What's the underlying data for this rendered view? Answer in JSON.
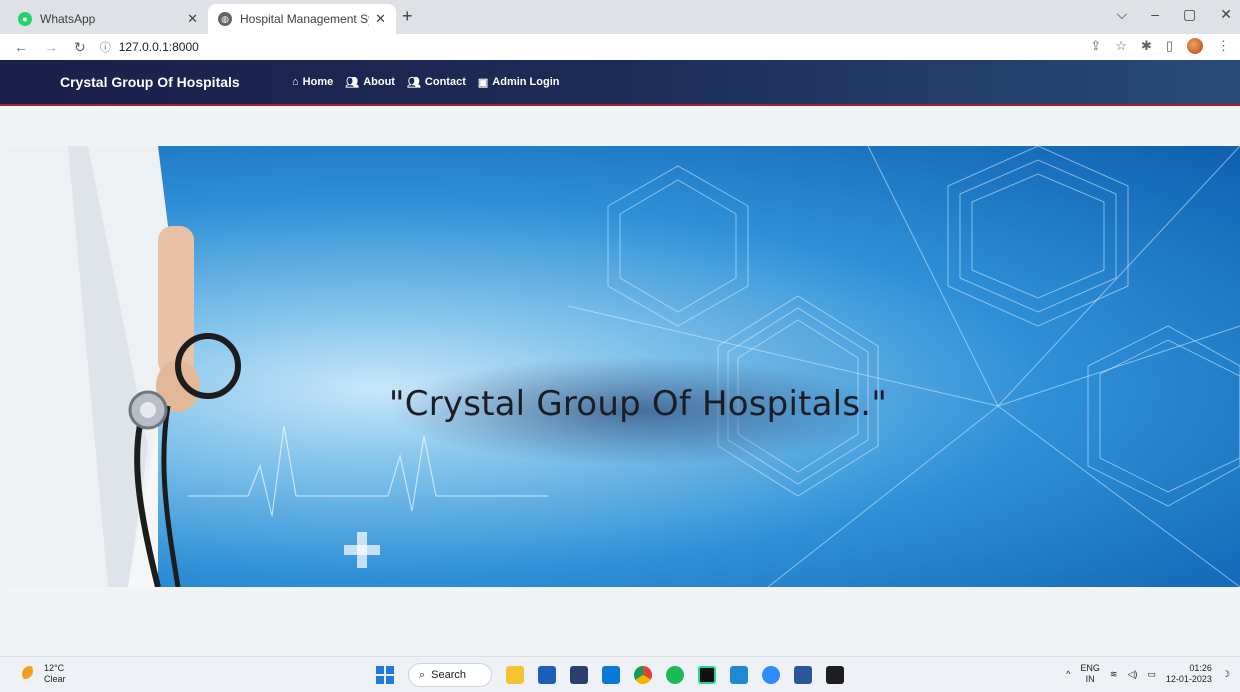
{
  "browser": {
    "tabs": [
      {
        "title": "WhatsApp",
        "active": false
      },
      {
        "title": "Hospital Management System",
        "active": true
      }
    ],
    "new_tab_symbol": "+",
    "url": "127.0.0.1:8000"
  },
  "navbar": {
    "brand": "Crystal Group Of Hospitals",
    "links": [
      {
        "label": "Home",
        "icon": "home-icon"
      },
      {
        "label": "About",
        "icon": "users-icon"
      },
      {
        "label": "Contact",
        "icon": "users-icon"
      },
      {
        "label": "Admin Login",
        "icon": "login-icon"
      }
    ]
  },
  "hero": {
    "title": "\"Crystal Group Of Hospitals.\""
  },
  "taskbar": {
    "weather": {
      "temp": "12°C",
      "condition": "Clear"
    },
    "search_label": "Search",
    "language": {
      "line1": "ENG",
      "line2": "IN"
    },
    "clock": {
      "time": "01:26",
      "date": "12-01-2023"
    }
  },
  "colors": {
    "navbar_start": "#1b1f4a",
    "navbar_end": "#2a4b78",
    "navbar_border": "#a32638",
    "hero_blue": "#2e8fd6"
  }
}
